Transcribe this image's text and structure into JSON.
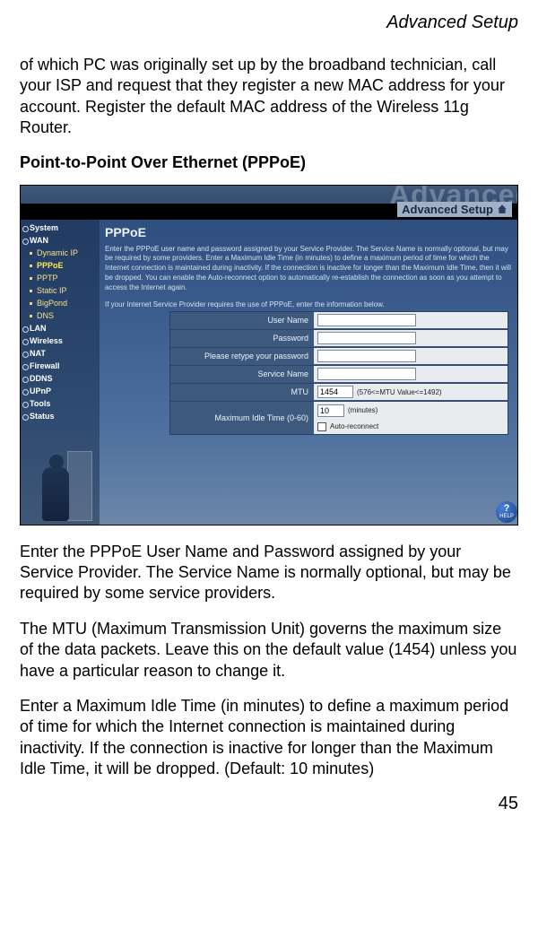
{
  "header": {
    "section": "Advanced Setup"
  },
  "paragraphs": {
    "intro": "of which PC was originally set up by the broadband technician, call your ISP and request that they register a new MAC address for your account. Register the default MAC address of the Wireless 11g Router.",
    "heading": "Point-to-Point Over Ethernet (PPPoE)",
    "after1": "Enter the PPPoE User Name and Password assigned by your Service Provider. The Service Name is normally optional, but may be required by some service providers.",
    "after2": "The MTU (Maximum Transmission Unit) governs the maximum size of the data packets. Leave this on the default value (1454) unless you have a particular reason to change it.",
    "after3": "Enter a Maximum Idle Time (in minutes) to define a maximum period of time for which the Internet connection is maintained during inactivity. If the connection is inactive for longer than the Maximum Idle Time, it will be dropped. (Default: 10 minutes)"
  },
  "page_number": "45",
  "router": {
    "brand_word": "Advanced",
    "setup_label": "Advanced Setup",
    "sidebar": {
      "items": [
        {
          "label": "System",
          "type": "top"
        },
        {
          "label": "WAN",
          "type": "top"
        },
        {
          "label": "Dynamic IP",
          "type": "sub"
        },
        {
          "label": "PPPoE",
          "type": "sub",
          "active": true
        },
        {
          "label": "PPTP",
          "type": "sub"
        },
        {
          "label": "Static IP",
          "type": "sub"
        },
        {
          "label": "BigPond",
          "type": "sub"
        },
        {
          "label": "DNS",
          "type": "sub"
        },
        {
          "label": "LAN",
          "type": "top"
        },
        {
          "label": "Wireless",
          "type": "top"
        },
        {
          "label": "NAT",
          "type": "top"
        },
        {
          "label": "Firewall",
          "type": "top"
        },
        {
          "label": "DDNS",
          "type": "top"
        },
        {
          "label": "UPnP",
          "type": "top"
        },
        {
          "label": "Tools",
          "type": "top"
        },
        {
          "label": "Status",
          "type": "top"
        }
      ]
    },
    "main": {
      "title": "PPPoE",
      "desc1": "Enter the PPPoE user name and password assigned by your Service Provider. The Service Name is normally optional, but may be required by some providers. Enter a Maximum Idle Time (in minutes) to define a maximum period of time for which the Internet connection is maintained during inactivity. If the connection is inactive for longer than the Maximum Idle Time, then it will be dropped. You can enable the Auto-reconnect option to automatically re-establish the connection as soon as you attempt to access the Internet again.",
      "desc2": "If your Internet Service Provider requires the use of PPPoE, enter the information below.",
      "form": {
        "user_name_label": "User Name",
        "password_label": "Password",
        "retype_label": "Please retype your password",
        "service_name_label": "Service Name",
        "mtu_label": "MTU",
        "mtu_value": "1454",
        "mtu_hint": "(576<=MTU Value<=1492)",
        "idle_label": "Maximum Idle Time (0-60)",
        "idle_value": "10",
        "idle_hint": "(minutes)",
        "auto_reconnect": "Auto-reconnect"
      }
    },
    "help": {
      "q": "?",
      "label": "HELP"
    }
  }
}
